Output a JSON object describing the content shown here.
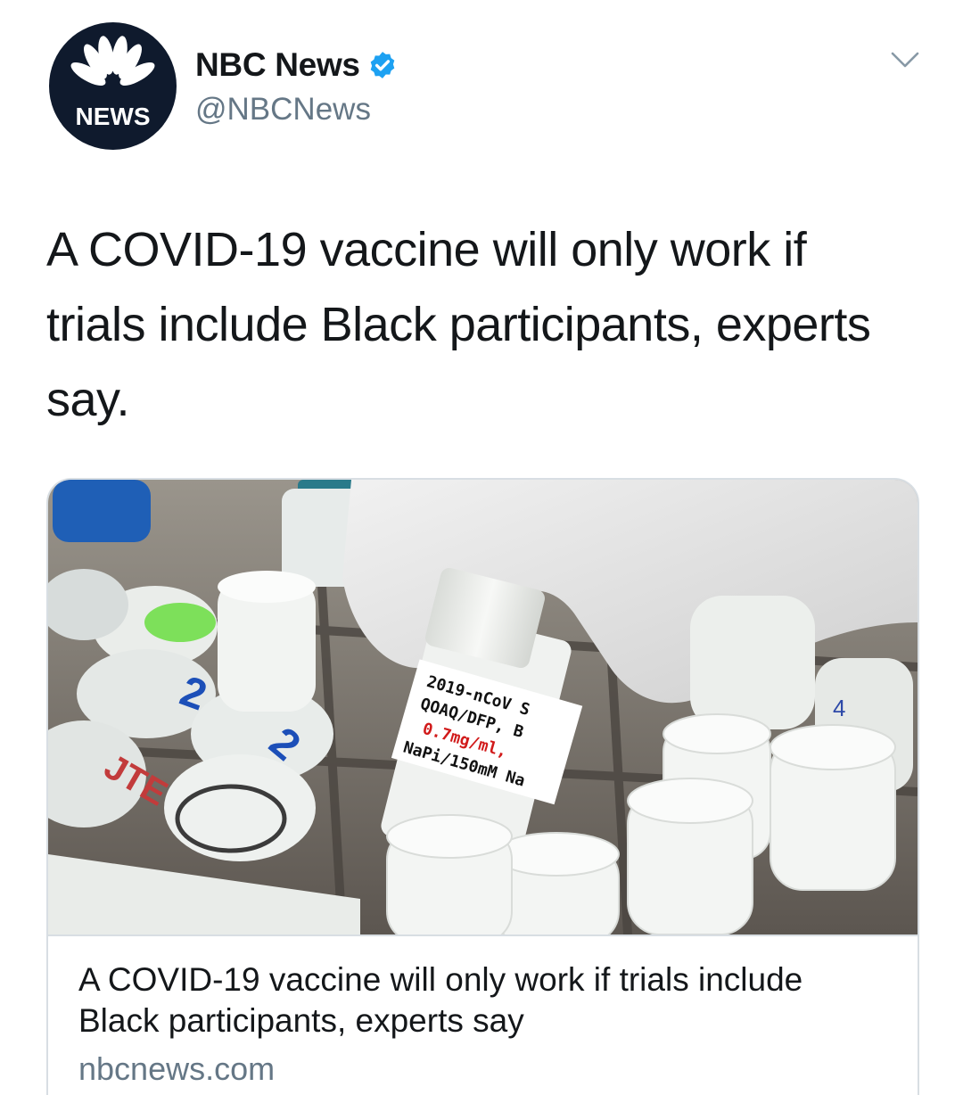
{
  "author": {
    "display_name": "NBC News",
    "handle": "@NBCNews",
    "verified": true,
    "avatar_text": "NEWS"
  },
  "tweet": {
    "text": "A COVID-19 vaccine will only work if trials include Black participants, experts say."
  },
  "card": {
    "title": "A COVID-19 vaccine will only work if trials include Black participants, experts say",
    "domain": "nbcnews.com",
    "image_label_lines": [
      "2019-nCoV S",
      "QOAQ/DFP, B",
      "0.7mg/ml,",
      "NaPi/150mM Na"
    ]
  },
  "icons": {
    "menu": "chevron-down-icon",
    "verified": "verified-badge-icon",
    "logo": "nbc-peacock-logo"
  },
  "colors": {
    "verified_blue": "#1da1f2",
    "avatar_bg": "#0f1a2d",
    "secondary_text": "#657786"
  }
}
